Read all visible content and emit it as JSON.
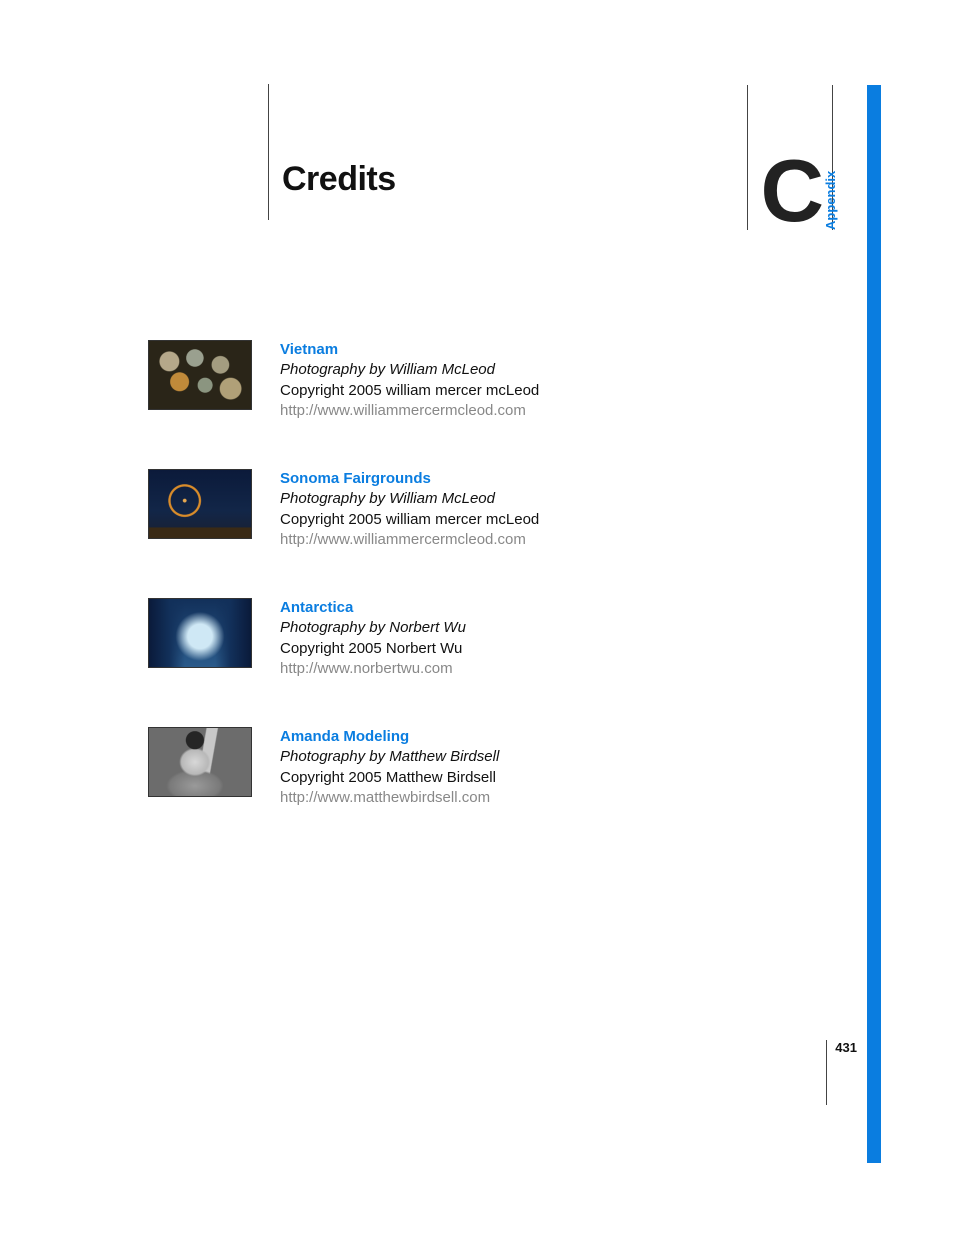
{
  "header": {
    "title": "Credits",
    "section_letter": "C",
    "section_label": "Appendix"
  },
  "credits": [
    {
      "title": "Vietnam",
      "byline": "Photography by William McLeod",
      "copyright": "Copyright 2005 william mercer mcLeod",
      "url": "http://www.williammercermcleod.com",
      "thumb_class": "thumb-vietnam"
    },
    {
      "title": "Sonoma Fairgrounds",
      "byline": "Photography by William McLeod",
      "copyright": "Copyright 2005 william mercer mcLeod",
      "url": "http://www.williammercermcleod.com",
      "thumb_class": "thumb-sonoma"
    },
    {
      "title": "Antarctica",
      "byline": "Photography by Norbert Wu",
      "copyright": "Copyright 2005 Norbert Wu",
      "url": "http://www.norbertwu.com",
      "thumb_class": "thumb-antarctica"
    },
    {
      "title": "Amanda Modeling",
      "byline": "Photography by Matthew Birdsell",
      "copyright": "Copyright 2005 Matthew Birdsell",
      "url": "http://www.matthewbirdsell.com",
      "thumb_class": "thumb-amanda"
    }
  ],
  "page_number": "431"
}
